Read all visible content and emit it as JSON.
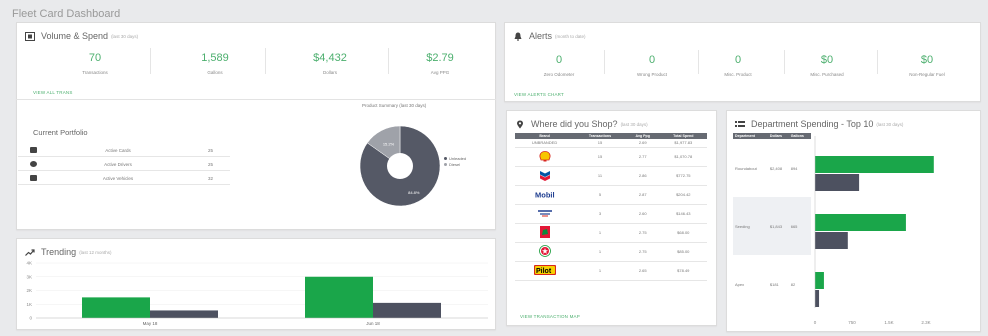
{
  "page": {
    "title": "Fleet Card Dashboard"
  },
  "volume": {
    "title": "Volume & Spend",
    "subtitle": "(last 30 days)",
    "stats": [
      {
        "value": "70",
        "label": "Transactions"
      },
      {
        "value": "1,589",
        "label": "Gallons"
      },
      {
        "value": "$4,432",
        "label": "Dollars"
      },
      {
        "value": "$2.79",
        "label": "Avg PPG"
      }
    ],
    "link": "VIEW ALL TRANS",
    "portfolio_title": "Current Portfolio",
    "portfolio": [
      {
        "icon": "credit-card-icon",
        "label": "Active Cards",
        "value": "25"
      },
      {
        "icon": "driver-icon",
        "label": "Active Drivers",
        "value": "25"
      },
      {
        "icon": "vehicle-icon",
        "label": "Active Vehicles",
        "value": "32"
      }
    ]
  },
  "pie": {
    "title": "Product Summary (last 30 days)",
    "legend": [
      "Unleaded",
      "Diesel"
    ]
  },
  "alerts": {
    "title": "Alerts",
    "subtitle": "(month to date)",
    "stats": [
      {
        "value": "0",
        "label": "Zero Odometer"
      },
      {
        "value": "0",
        "label": "Wrong Product"
      },
      {
        "value": "0",
        "label": "Misc. Product"
      },
      {
        "value": "$0",
        "label": "Misc. Purchased"
      },
      {
        "value": "$0",
        "label": "Non-Regular Fuel"
      }
    ],
    "link": "VIEW ALERTS CHART"
  },
  "shop": {
    "title": "Where did you Shop?",
    "subtitle": "(last 30 days)",
    "headers": [
      "Brand",
      "Transactions",
      "Avg Ppg",
      "Total Spend"
    ],
    "rows": [
      {
        "brand": "UNBRANDED",
        "logo": "unbranded",
        "tx": "15",
        "ppg": "2.69",
        "spend": "$1,977.83"
      },
      {
        "brand": "Shell",
        "logo": "shell-logo-icon",
        "tx": "15",
        "ppg": "2.77",
        "spend": "$1,070.78"
      },
      {
        "brand": "Chevron",
        "logo": "chevron-logo-icon",
        "tx": "11",
        "ppg": "2.86",
        "spend": "$772.75"
      },
      {
        "brand": "Mobil",
        "logo": "mobil-logo-icon",
        "tx": "5",
        "ppg": "2.87",
        "spend": "$204.42"
      },
      {
        "brand": "Murphy USA",
        "logo": "murphy-logo-icon",
        "tx": "3",
        "ppg": "2.60",
        "spend": "$146.43"
      },
      {
        "brand": "Sinclair",
        "logo": "sinclair-logo-icon",
        "tx": "1",
        "ppg": "2.75",
        "spend": "$68.00"
      },
      {
        "brand": "Texaco",
        "logo": "texaco-logo-icon",
        "tx": "1",
        "ppg": "2.75",
        "spend": "$85.00"
      },
      {
        "brand": "Pilot",
        "logo": "pilot-logo-icon",
        "tx": "1",
        "ppg": "2.65",
        "spend": "$78.49"
      }
    ],
    "link": "VIEW TRANSACTION MAP"
  },
  "dept": {
    "title": "Department Spending - Top 10",
    "subtitle": "(last 30 days)",
    "headers": [
      "Department",
      "Dollars",
      "Gallons"
    ],
    "rows": [
      {
        "name": "Roundabout",
        "dollars": "$2,408",
        "gallons": "894"
      },
      {
        "name": "Seeding",
        "dollars": "$1,843",
        "gallons": "665"
      },
      {
        "name": "Apex",
        "dollars": "$181",
        "gallons": "82"
      }
    ]
  },
  "trending": {
    "title": "Trending",
    "subtitle": "(last 12 months)"
  },
  "chart_data": [
    {
      "type": "pie",
      "title": "Product Summary (last 30 days)",
      "slices": [
        {
          "name": "Unleaded",
          "value": 84.8,
          "label": "84.8%",
          "color": "#555966"
        },
        {
          "name": "Diesel",
          "value": 15.2,
          "label": "15.2%",
          "color": "#9fa2a9"
        }
      ]
    },
    {
      "type": "bar",
      "title": "Department Spending - Top 10",
      "orientation": "horizontal",
      "categories": [
        "Roundabout",
        "Seeding",
        "Apex"
      ],
      "series": [
        {
          "name": "Dollars",
          "color": "#1aa64a",
          "values": [
            2408,
            1843,
            181
          ]
        },
        {
          "name": "Gallons",
          "color": "#4d5160",
          "values": [
            894,
            665,
            82
          ]
        }
      ],
      "xticks": [
        "0",
        "750",
        "1.5K",
        "2.3K"
      ],
      "xlim": [
        0,
        3000
      ]
    },
    {
      "type": "bar",
      "title": "Trending",
      "categories": [
        "May 18",
        "Jun 18"
      ],
      "series": [
        {
          "name": "Dollars",
          "color": "#1aa64a",
          "values": [
            1500,
            3000
          ]
        },
        {
          "name": "Gallons",
          "color": "#4d5160",
          "values": [
            550,
            1100
          ]
        }
      ],
      "yticks": [
        "0",
        "1K",
        "2K",
        "3K",
        "4K"
      ],
      "ylim": [
        0,
        4000
      ]
    }
  ]
}
